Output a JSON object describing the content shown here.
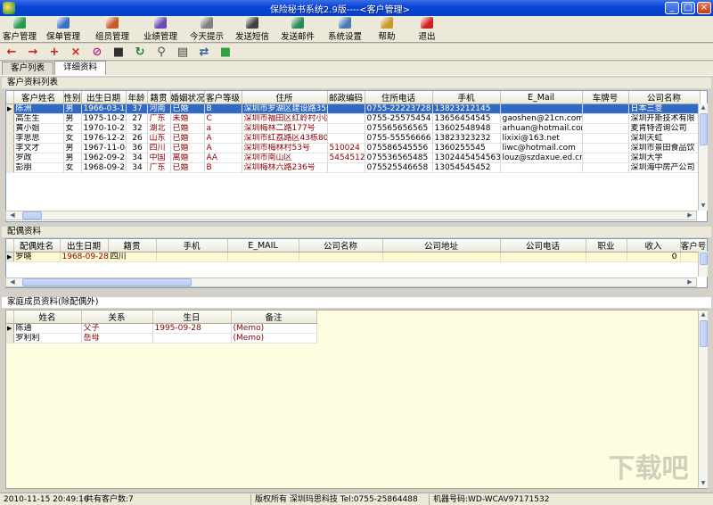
{
  "window": {
    "title": "保险秘书系统2.9版----<客户管理>",
    "min": "_",
    "max": "□",
    "close": "×"
  },
  "menu": [
    {
      "label": "客户管理",
      "icon": "customer-icon",
      "color": "#2a9a4a"
    },
    {
      "label": "保单管理",
      "icon": "policy-icon",
      "color": "#3a6ec8"
    },
    {
      "label": "组员管理",
      "icon": "team-icon",
      "color": "#c85a2a"
    },
    {
      "label": "业绩管理",
      "icon": "performance-icon",
      "color": "#6a4ab0"
    },
    {
      "label": "今天提示",
      "icon": "alarm-clock-icon",
      "color": "#808080"
    },
    {
      "label": "发送短信",
      "icon": "sms-icon",
      "color": "#404040"
    },
    {
      "label": "发送邮件",
      "icon": "email-icon",
      "color": "#2a8a5a"
    },
    {
      "label": "系统设置",
      "icon": "settings-icon",
      "color": "#4a7ab0"
    },
    {
      "label": "帮助",
      "icon": "help-icon",
      "color": "#c89a2a"
    },
    {
      "label": "退出",
      "icon": "exit-icon",
      "color": "#d02020"
    }
  ],
  "toolbar": [
    {
      "name": "prev-record-icon",
      "glyph": "←",
      "color": "#d02020"
    },
    {
      "name": "next-record-icon",
      "glyph": "→",
      "color": "#d02020"
    },
    {
      "name": "add-record-icon",
      "glyph": "+",
      "color": "#d02020"
    },
    {
      "name": "delete-record-icon",
      "glyph": "×",
      "color": "#d02020"
    },
    {
      "name": "cancel-edit-icon",
      "glyph": "⊘",
      "color": "#c02080"
    },
    {
      "name": "save-icon",
      "glyph": "■",
      "color": "#303030"
    },
    {
      "name": "refresh-icon",
      "glyph": "↻",
      "color": "#208030"
    },
    {
      "name": "search-icon",
      "glyph": "⚲",
      "color": "#505050"
    },
    {
      "name": "print-icon",
      "glyph": "▤",
      "color": "#404040"
    },
    {
      "name": "export-icon",
      "glyph": "⇄",
      "color": "#3060a0"
    },
    {
      "name": "exit-toolbar-icon",
      "glyph": "■",
      "color": "#30a040"
    }
  ],
  "tabs": [
    {
      "label": "客户列表"
    },
    {
      "label": "详细资料"
    }
  ],
  "customers": {
    "section_label": "客户资料列表",
    "columns": [
      "客户姓名",
      "性别",
      "出生日期",
      "年龄",
      "籍贯",
      "婚姻状况",
      "客户等级",
      "住所",
      "邮政编码",
      "住所电话",
      "手机",
      "E_Mail",
      "车牌号",
      "公司名称"
    ],
    "widths": [
      56,
      20,
      50,
      24,
      26,
      38,
      42,
      96,
      42,
      76,
      76,
      92,
      52,
      80
    ],
    "rows": [
      [
        "陈洲",
        "男",
        "1966-03-15",
        "37",
        "河南",
        "已婚",
        "B",
        "深圳市罗湖区建设路35号",
        "",
        "0755-22223728",
        "13823212145",
        "",
        "",
        "日本三菱"
      ],
      [
        "高生生",
        "男",
        "1975-10-22",
        "27",
        "广东",
        "未婚",
        "C",
        "深圳市福田区红岭村小区",
        "",
        "0755-25575454",
        "13656454545",
        "gaoshen@21cn.com",
        "",
        "深圳开斯技术有限"
      ],
      [
        "黄小姐",
        "女",
        "1970-10-21",
        "32",
        "湖北",
        "已婚",
        "a",
        "深圳梅林二路177号",
        "",
        "075565656565",
        "13602548948",
        "arhuan@hotmail.com",
        "",
        "麦肯特咨询公司"
      ],
      [
        "李思思",
        "女",
        "1976-12-26",
        "26",
        "山东",
        "已婚",
        "A",
        "深圳市红荔路区43栋801",
        "",
        "0755-55556666",
        "13823323232",
        "lixixi@163.net",
        "",
        "深圳天虹"
      ],
      [
        "李文才",
        "男",
        "1967-11-04",
        "36",
        "四川",
        "已婚",
        "A",
        "深圳市梅林村53号",
        "510024",
        "075586545556",
        "1360255545",
        "liwc@hotmail.com",
        "",
        "深圳市景田食品饮"
      ],
      [
        "罗政",
        "男",
        "1962-09-28",
        "34",
        "中国",
        "离婚",
        "AA",
        "深圳市南山区",
        "54545126",
        "075536565485",
        "13024454545636",
        "louz@szdaxue.ed.cn",
        "",
        "深圳大学"
      ],
      [
        "彭朋",
        "女",
        "1968-09-28",
        "34",
        "广东",
        "已婚",
        "B",
        "深圳梅林六路236号",
        "",
        "075525546658",
        "13054545452",
        "",
        "",
        "深圳海中房产公司"
      ]
    ]
  },
  "spouse": {
    "section_label": "配偶资料",
    "columns": [
      "配偶姓名",
      "出生日期",
      "籍贯",
      "手机",
      "E_MAIL",
      "公司名称",
      "公司地址",
      "公司电话",
      "职业",
      "收入",
      "客户号"
    ],
    "widths": [
      52,
      54,
      54,
      80,
      80,
      94,
      132,
      96,
      46,
      60,
      30
    ],
    "rows": [
      [
        "罗晓",
        "1968-09-28",
        "四川",
        "",
        "",
        "",
        "",
        "",
        "",
        "0",
        ""
      ]
    ]
  },
  "family": {
    "section_label": "家庭成员资料(除配偶外)",
    "columns": [
      "姓名",
      "关系",
      "生日",
      "备注"
    ],
    "widths": [
      76,
      80,
      88,
      96
    ],
    "rows": [
      [
        "陈通",
        "父子",
        "1995-09-28",
        "(Memo)"
      ],
      [
        "罗利利",
        "岳母",
        "",
        "(Memo)"
      ]
    ]
  },
  "status": {
    "datetime": "2010-11-15 20:49:16",
    "count": "共有客户数:7",
    "copyright": "版权所有 深圳玛思科技 Tel:0755-25864488",
    "machine": "机器号码:WD-WCAV97171532"
  }
}
